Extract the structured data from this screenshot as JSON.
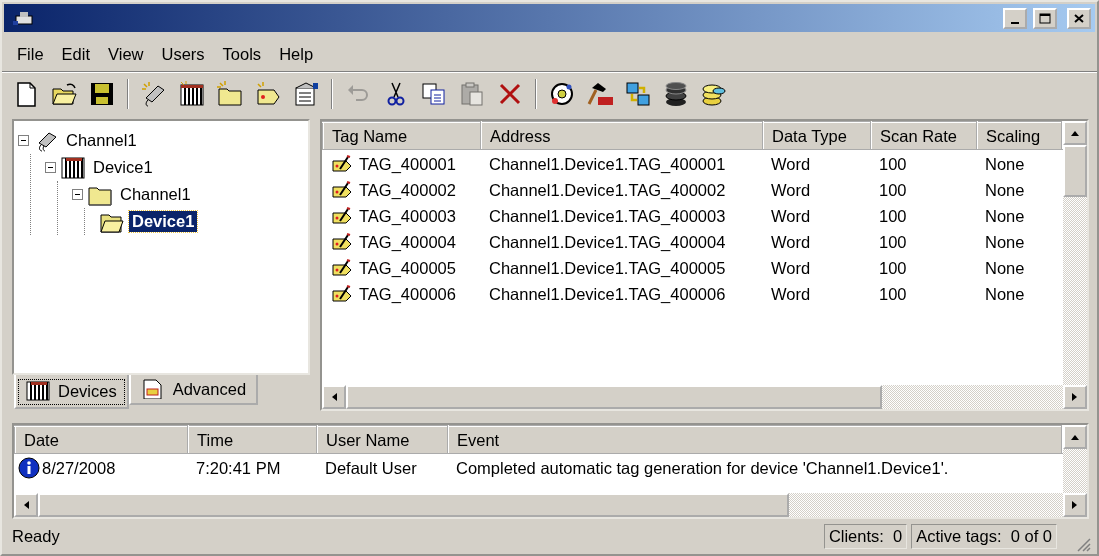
{
  "menu": [
    {
      "label": "File"
    },
    {
      "label": "Edit"
    },
    {
      "label": "View"
    },
    {
      "label": "Users"
    },
    {
      "label": "Tools"
    },
    {
      "label": "Help"
    }
  ],
  "toolbar": [
    {
      "kind": "new",
      "disabled": false
    },
    {
      "kind": "open",
      "disabled": false
    },
    {
      "kind": "save",
      "disabled": false
    },
    {
      "kind": "separator"
    },
    {
      "kind": "channel",
      "disabled": false
    },
    {
      "kind": "device",
      "disabled": false
    },
    {
      "kind": "group",
      "disabled": false
    },
    {
      "kind": "tag",
      "disabled": false
    },
    {
      "kind": "properties",
      "disabled": false
    },
    {
      "kind": "separator"
    },
    {
      "kind": "undo",
      "disabled": true
    },
    {
      "kind": "cut",
      "disabled": false
    },
    {
      "kind": "copy",
      "disabled": false
    },
    {
      "kind": "paste",
      "disabled": true
    },
    {
      "kind": "delete",
      "disabled": false
    },
    {
      "kind": "separator"
    },
    {
      "kind": "client",
      "disabled": false
    },
    {
      "kind": "opc",
      "disabled": false
    },
    {
      "kind": "transfer",
      "disabled": false
    },
    {
      "kind": "database",
      "disabled": false
    },
    {
      "kind": "database2",
      "disabled": false
    }
  ],
  "tree": [
    {
      "label": "Channel1",
      "kind": "channel",
      "expanded": true,
      "selected": false,
      "children": [
        {
          "label": "Device1",
          "kind": "device",
          "expanded": true,
          "selected": false,
          "children": [
            {
              "label": "Channel1",
              "kind": "folder",
              "expanded": true,
              "selected": false,
              "children": [
                {
                  "label": "Device1",
                  "kind": "folder_open",
                  "selected": true
                }
              ]
            }
          ]
        }
      ]
    }
  ],
  "tabs": [
    {
      "label": "Devices",
      "kind": "devices",
      "selected": true
    },
    {
      "label": "Advanced",
      "kind": "advanced",
      "selected": false
    }
  ],
  "tag_table": {
    "columns": [
      "Tag Name",
      "Address",
      "Data Type",
      "Scan Rate",
      "Scaling"
    ],
    "rows": [
      [
        "TAG_400001",
        "Channel1.Device1.TAG_400001",
        "Word",
        "100",
        "None"
      ],
      [
        "TAG_400002",
        "Channel1.Device1.TAG_400002",
        "Word",
        "100",
        "None"
      ],
      [
        "TAG_400003",
        "Channel1.Device1.TAG_400003",
        "Word",
        "100",
        "None"
      ],
      [
        "TAG_400004",
        "Channel1.Device1.TAG_400004",
        "Word",
        "100",
        "None"
      ],
      [
        "TAG_400005",
        "Channel1.Device1.TAG_400005",
        "Word",
        "100",
        "None"
      ],
      [
        "TAG_400006",
        "Channel1.Device1.TAG_400006",
        "Word",
        "100",
        "None"
      ]
    ]
  },
  "event_log": {
    "columns": [
      "Date",
      "Time",
      "User Name",
      "Event"
    ],
    "rows": [
      {
        "kind": "info",
        "cells": [
          "8/27/2008",
          "7:20:41 PM",
          "Default User",
          "Completed automatic tag generation for device 'Channel1.Device1'."
        ]
      }
    ]
  },
  "status_bar": {
    "text": "Ready",
    "panes": [
      "Clients:  0",
      "Active tags:  0 of 0"
    ]
  }
}
